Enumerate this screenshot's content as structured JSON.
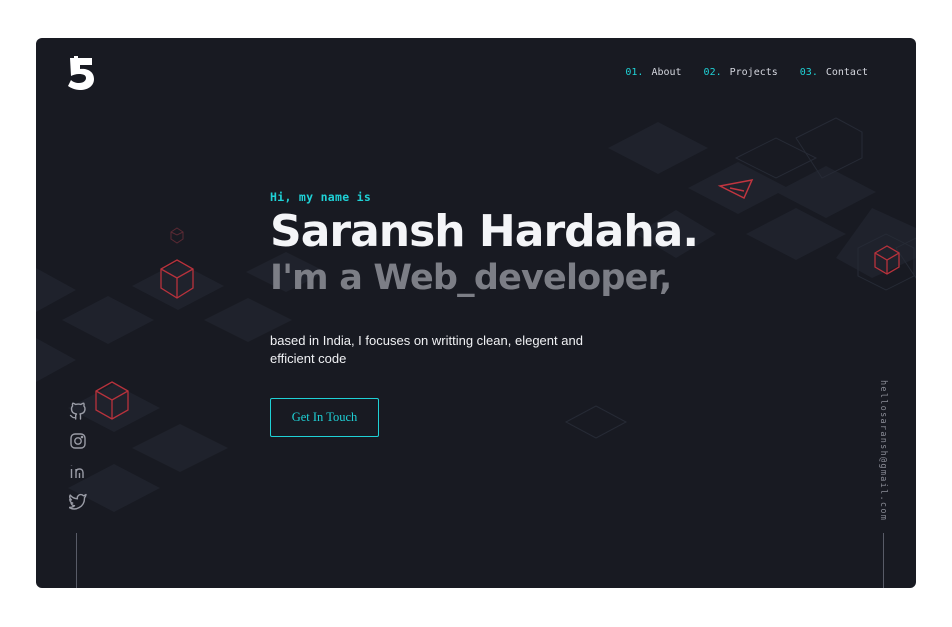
{
  "logo": {
    "alt": "5"
  },
  "nav": {
    "items": [
      {
        "num": "01.",
        "label": "About"
      },
      {
        "num": "02.",
        "label": "Projects"
      },
      {
        "num": "03.",
        "label": "Contact"
      }
    ]
  },
  "hero": {
    "greeting": "Hi, my name is",
    "name": "Saransh Hardaha.",
    "role": "I'm a Web_developer,",
    "description": "based in India, I focuses on writting clean, elegent and efficient code"
  },
  "cta": {
    "label": "Get In Touch"
  },
  "socials": [
    {
      "icon": "github-icon"
    },
    {
      "icon": "instagram-icon"
    },
    {
      "icon": "linkedin-icon"
    },
    {
      "icon": "twitter-icon"
    }
  ],
  "email": "hellosaransh@gmail.com",
  "colors": {
    "background": "#181a22",
    "accent": "#1fd1d6",
    "heading": "#f4f5f8",
    "subheading": "#7c7e86",
    "cube_red": "#b8323c"
  }
}
